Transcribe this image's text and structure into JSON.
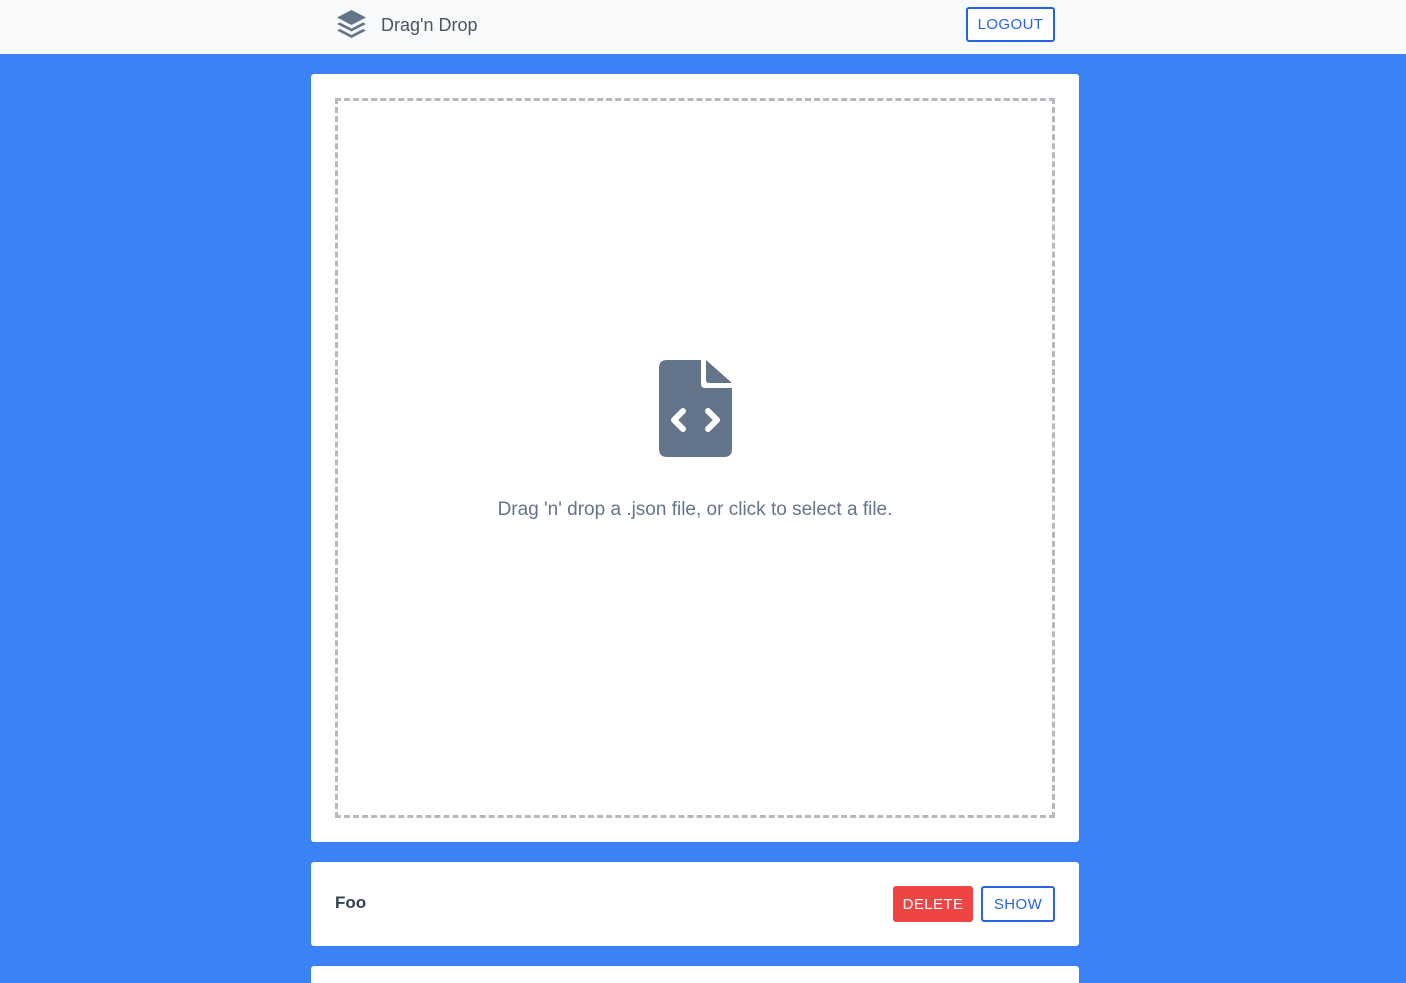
{
  "navbar": {
    "brand_icon": "layers-icon",
    "brand_text": "Drag'n Drop",
    "logout_label": "LOGOUT"
  },
  "upload": {
    "icon": "file-code-icon",
    "instructions": "Drag 'n' drop a .json file, or click to select a file."
  },
  "files": [
    {
      "name": "Foo",
      "delete_label": "DELETE",
      "show_label": "SHOW"
    }
  ],
  "colors": {
    "background": "#3b82f6",
    "navbar": "#f8f9fa",
    "primary": "#2563eb",
    "danger": "#ef4444",
    "icon": "#64748b"
  }
}
